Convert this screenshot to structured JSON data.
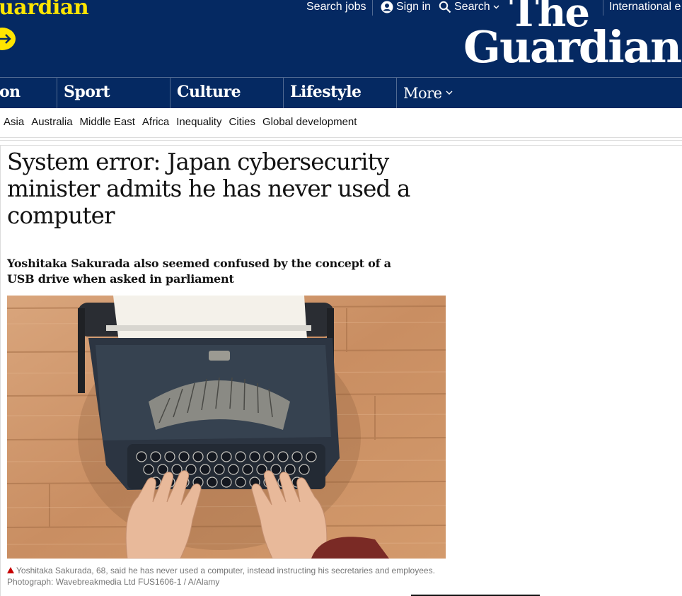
{
  "header": {
    "brand_partial": "uardian",
    "top_links": {
      "search_jobs": "Search jobs",
      "sign_in": "Sign in",
      "search": "Search",
      "edition": "International e"
    },
    "logo_line1": "The",
    "logo_line2": "Guardian"
  },
  "nav": {
    "items": [
      "on",
      "Sport",
      "Culture",
      "Lifestyle"
    ],
    "more": "More"
  },
  "subnav": {
    "items": [
      "Asia",
      "Australia",
      "Middle East",
      "Africa",
      "Inequality",
      "Cities",
      "Global development"
    ]
  },
  "article": {
    "headline": "System error: Japan cybersecurity minister admits he has never used a computer",
    "standfirst": "Yoshitaka Sakurada also seemed confused by the concept of a USB drive when asked in parliament",
    "caption": "Yoshitaka Sakurada, 68, said he has never used a computer, instead instructing his secretaries and employees.",
    "credit": "Photograph: Wavebreakmedia Ltd FUS1606-1 / A/Alamy"
  },
  "colors": {
    "brand_blue": "#052962",
    "brand_yellow": "#ffe500",
    "caption_triangle": "#c70000"
  }
}
